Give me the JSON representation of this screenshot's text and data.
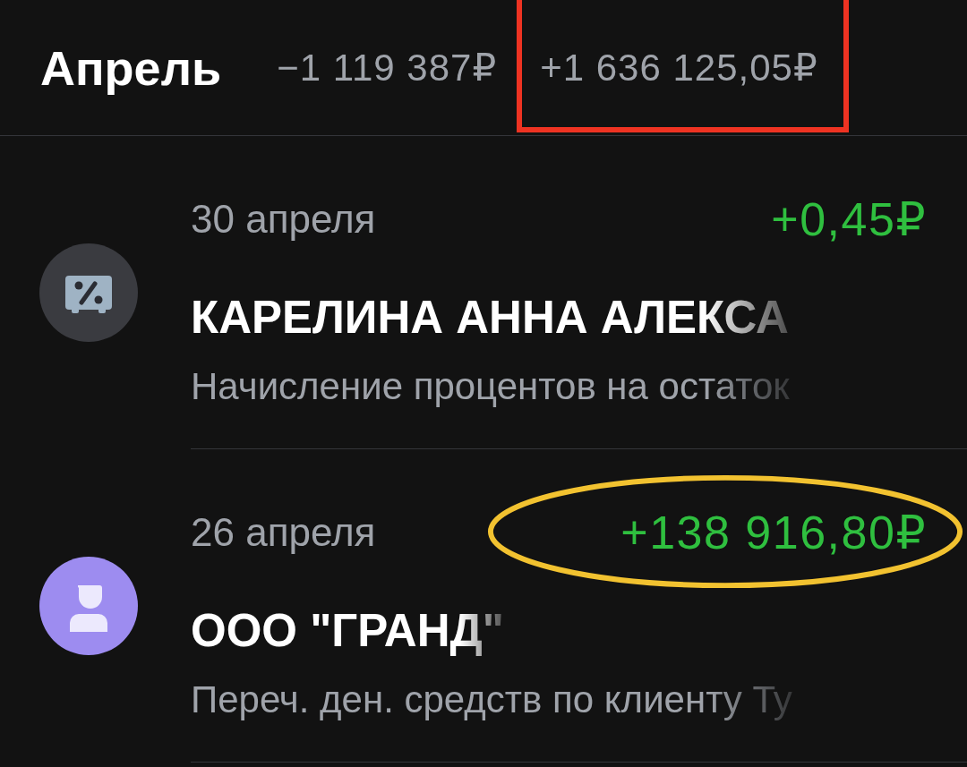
{
  "header": {
    "month": "Апрель",
    "totals": [
      {
        "kind": "expense",
        "text": "−1 119 387₽",
        "marked": false
      },
      {
        "kind": "income",
        "text": "+1 636 125,05₽",
        "marked": true
      }
    ]
  },
  "operations": [
    {
      "date": "30 апреля",
      "amount": "+0,45₽",
      "kind": "income",
      "marked": false,
      "name": "КАРЕЛИНА АННА АЛЕКСА",
      "description": "Начисление процентов на остаток"
    },
    {
      "date": "26 апреля",
      "amount": "+138 916,80₽",
      "kind": "income",
      "marked": true,
      "name": "ООО \"ГРАНД\"",
      "description": "Переч. ден. средств по клиенту Ту"
    }
  ]
}
